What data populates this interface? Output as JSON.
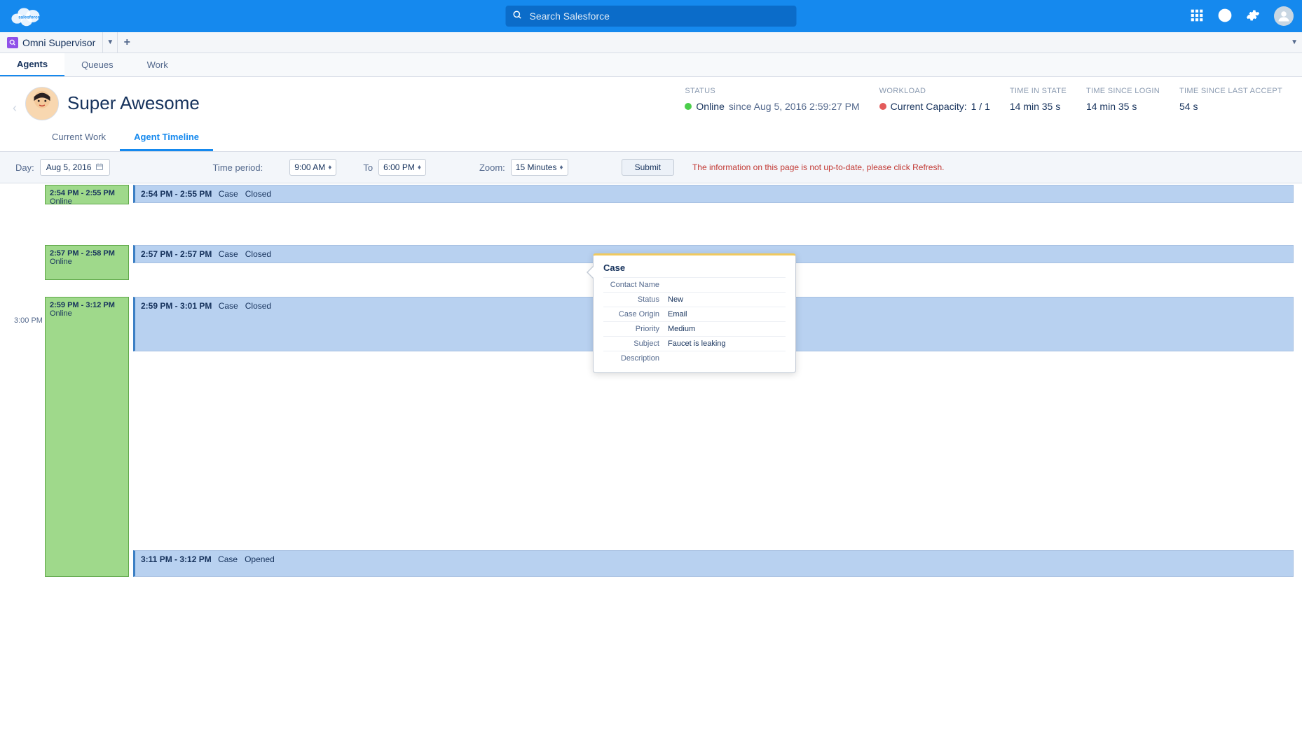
{
  "search": {
    "placeholder": "Search Salesforce"
  },
  "app": {
    "name": "Omni Supervisor"
  },
  "tabs": [
    "Agents",
    "Queues",
    "Work"
  ],
  "agent": {
    "name": "Super Awesome",
    "stats": {
      "status_label": "STATUS",
      "status_value_prefix": "Online",
      "status_since": "since  Aug 5, 2016 2:59:27 PM",
      "workload_label": "WORKLOAD",
      "workload_prefix": "Current Capacity:",
      "workload_value": "1 / 1",
      "time_in_state_label": "TIME IN STATE",
      "time_in_state_value": "14 min 35 s",
      "time_since_login_label": "TIME SINCE LOGIN",
      "time_since_login_value": "14 min 35 s",
      "time_since_last_accept_label": "TIME SINCE LAST ACCEPT",
      "time_since_last_accept_value": "54 s"
    },
    "subtabs": [
      "Current Work",
      "Agent Timeline"
    ]
  },
  "filter": {
    "day_label": "Day:",
    "day_value": "Aug 5, 2016",
    "time_period_label": "Time period:",
    "time_from": "9:00 AM",
    "to_label": "To",
    "time_to": "6:00 PM",
    "zoom_label": "Zoom:",
    "zoom_value": "15 Minutes",
    "submit_label": "Submit",
    "warning": "The information on this page is not up-to-date, please click Refresh."
  },
  "timeline": {
    "gutter_label": "3:00 PM",
    "blocks": [
      {
        "status_time": "2:54 PM - 2:55 PM",
        "status_text": "Online",
        "work_time": "2:54 PM - 2:55 PM",
        "work_type": "Case",
        "work_status": "Closed"
      },
      {
        "status_time": "2:57 PM - 2:58 PM",
        "status_text": "Online",
        "work_time": "2:57 PM - 2:57 PM",
        "work_type": "Case",
        "work_status": "Closed"
      },
      {
        "status_time": "2:59 PM - 3:12 PM",
        "status_text": "Online",
        "work_time": "2:59 PM - 3:01 PM",
        "work_type": "Case",
        "work_status": "Closed",
        "work_time2": "3:11 PM - 3:12 PM",
        "work_type2": "Case",
        "work_status2": "Opened"
      }
    ]
  },
  "popover": {
    "title": "Case",
    "rows": [
      {
        "label": "Contact Name",
        "value": ""
      },
      {
        "label": "Status",
        "value": "New"
      },
      {
        "label": "Case Origin",
        "value": "Email"
      },
      {
        "label": "Priority",
        "value": "Medium"
      },
      {
        "label": "Subject",
        "value": "Faucet is leaking"
      },
      {
        "label": "Description",
        "value": ""
      }
    ]
  }
}
